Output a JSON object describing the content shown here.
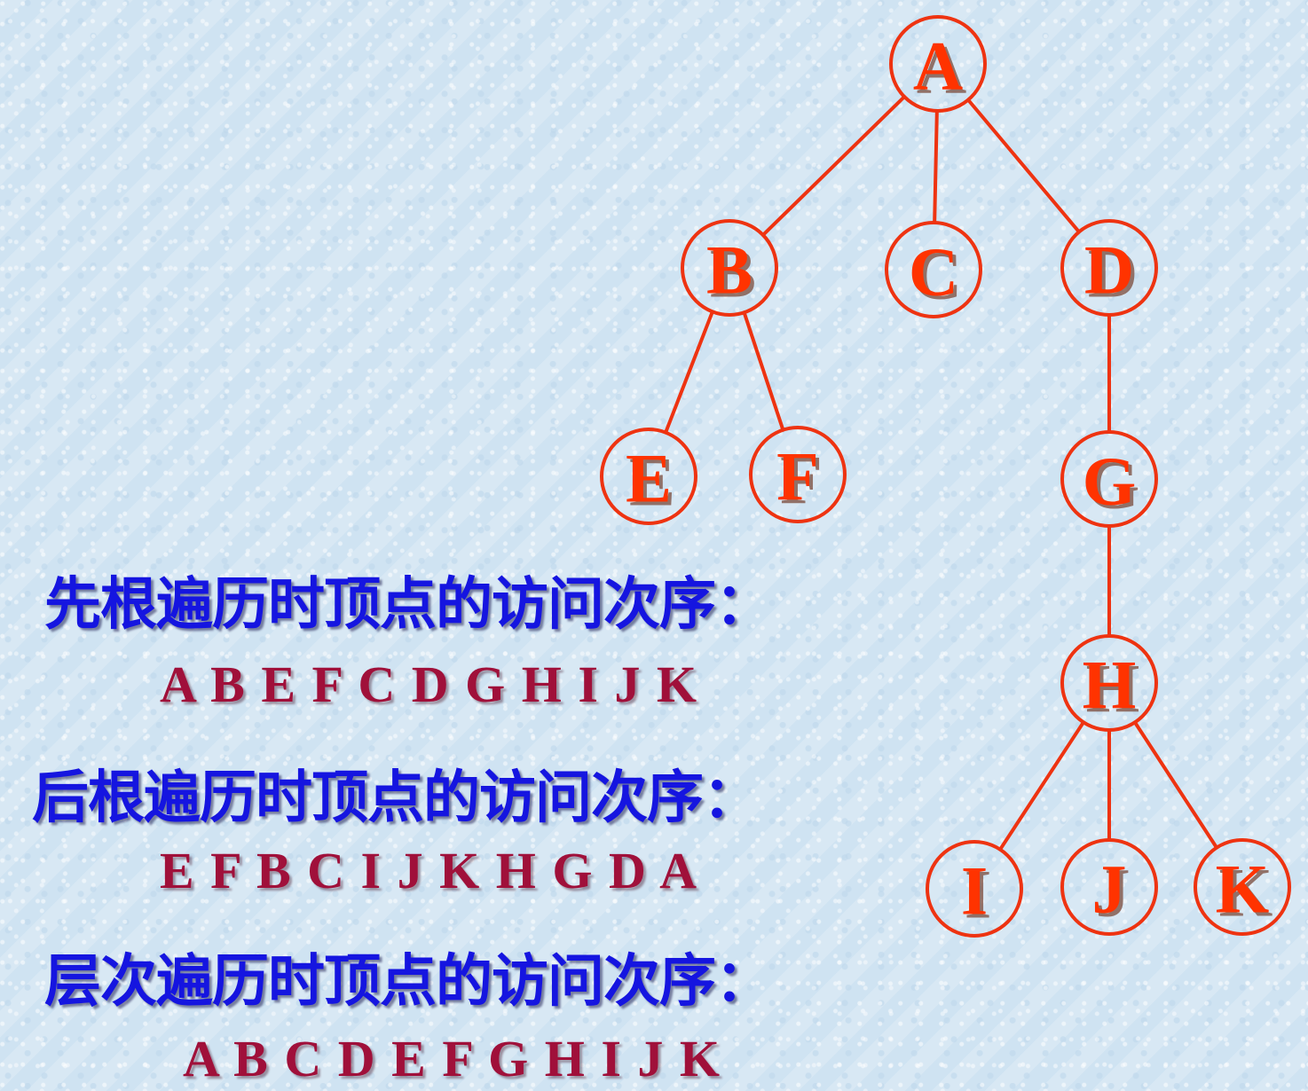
{
  "tree": {
    "nodes": [
      "A",
      "B",
      "C",
      "D",
      "E",
      "F",
      "G",
      "H",
      "I",
      "J",
      "K"
    ],
    "edges": [
      [
        "A",
        "B"
      ],
      [
        "A",
        "C"
      ],
      [
        "A",
        "D"
      ],
      [
        "B",
        "E"
      ],
      [
        "B",
        "F"
      ],
      [
        "D",
        "G"
      ],
      [
        "G",
        "H"
      ],
      [
        "H",
        "I"
      ],
      [
        "H",
        "J"
      ],
      [
        "H",
        "K"
      ]
    ]
  },
  "traversals": {
    "preorder": {
      "heading": "先根遍历时顶点的访问次序：",
      "sequence": "A B E F C D G H I J K"
    },
    "postorder": {
      "heading": "后根遍历时顶点的访问次序：",
      "sequence": "E F B C I J K H G D A"
    },
    "levelorder": {
      "heading": "层次遍历时顶点的访问次序：",
      "sequence": "A B C D E F G H I J K"
    }
  },
  "colors": {
    "node_stroke": "#ee3311",
    "node_text": "#ff3300",
    "heading_text": "#1515e0",
    "sequence_text": "#a0103a"
  }
}
